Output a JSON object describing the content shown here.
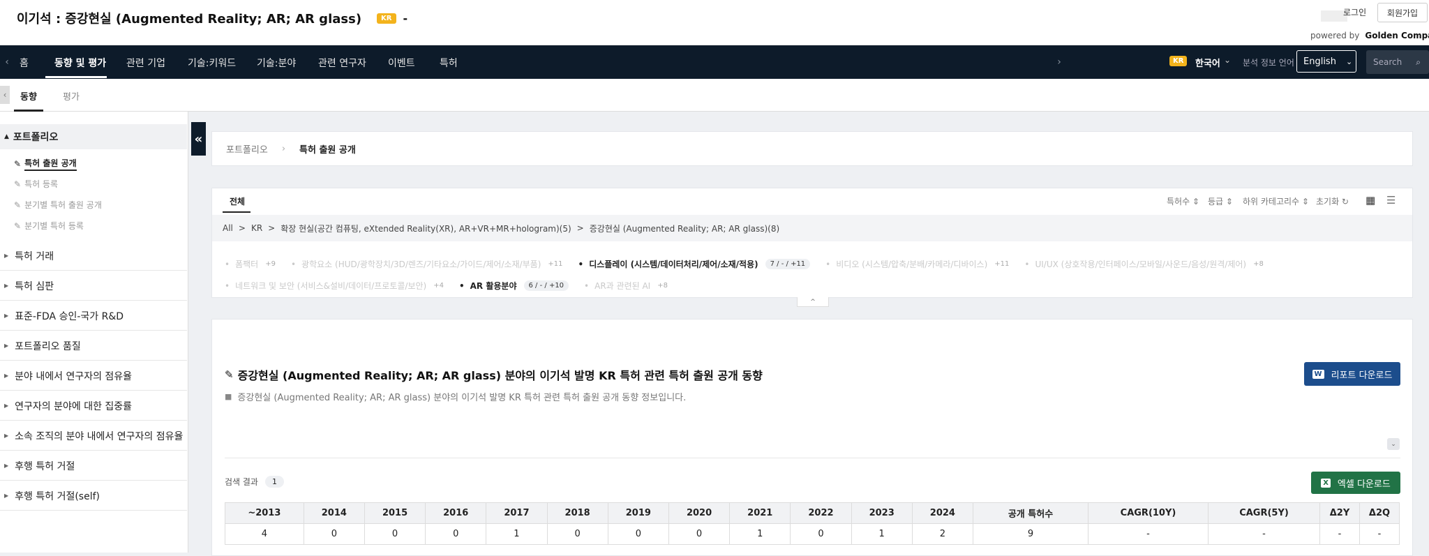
{
  "header": {
    "title": "이기석 : 증강현실 (Augmented Reality; AR; AR glass)",
    "country_badge": "KR",
    "dash": "-",
    "login": "로그인",
    "signup": "회원가입",
    "powered_by": "powered by",
    "brand": "Golden Compass"
  },
  "nav": {
    "items": [
      "홈",
      "동향 및 평가",
      "관련 기업",
      "기술:키워드",
      "기술:분야",
      "관련 연구자",
      "이벤트",
      "특허"
    ],
    "active_index": 1,
    "lang_badge": "KR",
    "lang": "한국어",
    "analysis_lang_label": "분석 정보 언어",
    "language_select": "English",
    "search_placeholder": "Search"
  },
  "subtabs": [
    "동향",
    "평가"
  ],
  "sidebar": {
    "header": "포트폴리오",
    "sub_items": [
      "특허 출원 공개",
      "특허 등록",
      "분기별 특허 출원 공개",
      "분기별 특허 등록"
    ],
    "categories": [
      "특허 거래",
      "특허 심판",
      "표준-FDA 승인-국가 R&D",
      "포트폴리오 품질",
      "분야 내에서 연구자의 점유율",
      "연구자의 분야에 대한 집중률",
      "소속 조직의 분야 내에서 연구자의 점유율",
      "후행 특허 거절",
      "후행 특허 거절(self)"
    ]
  },
  "breadcrumb": {
    "root": "포트폴리오",
    "sep": "›",
    "current": "특허 출원 공개"
  },
  "filter": {
    "tab": "전체",
    "sorts": [
      "특허수 ⇕",
      "등급 ⇕",
      "하위 카테고리수 ⇕",
      "초기화 ↻"
    ],
    "path": [
      "All",
      "KR",
      "확장 현실(공간 컴퓨팅, eXtended Reality(XR), AR+VR+MR+hologram)(5)",
      "증강현실 (Augmented Reality; AR; AR glass)(8)"
    ],
    "path_sep": ">",
    "tags_row1": [
      {
        "label": "폼팩터",
        "count": "+9",
        "strong": false
      },
      {
        "label": "광학요소 (HUD/광학장치/3D/렌즈/기타요소/가이드/제어/소재/부품)",
        "count": "+11",
        "strong": false
      },
      {
        "label": "디스플레이 (시스템/데이터처리/제어/소재/적용)",
        "count": "7 / - / +11",
        "strong": true
      },
      {
        "label": "비디오 (시스템/압축/분배/카메라/디바이스)",
        "count": "+11",
        "strong": false
      },
      {
        "label": "UI/UX (상호작용/인터페이스/모바일/사운드/음성/원격/제어)",
        "count": "+8",
        "strong": false
      }
    ],
    "tags_row2": [
      {
        "label": "네트워크 및 보안 (서비스&설비/데이터/프로토콜/보안)",
        "count": "+4",
        "strong": false
      },
      {
        "label": "AR 활용분야",
        "count": "6 / - / +10",
        "strong": true
      },
      {
        "label": "AR과 관련된 AI",
        "count": "+8",
        "strong": false
      }
    ],
    "toggle": "^"
  },
  "main": {
    "title": "증강현실 (Augmented Reality; AR; AR glass) 분야의 이기석 발명 KR 특허 관련 특허 출원 공개 동향",
    "desc": "증강현실 (Augmented Reality; AR; AR glass) 분야의 이기석 발명 KR 특허 관련 특허 출원 공개 동향 정보입니다.",
    "report_btn": "리포트 다운로드",
    "results_label": "검색 결과",
    "results_count": "1",
    "excel_btn": "엑셀 다운로드"
  },
  "table": {
    "headers": [
      "~2013",
      "2014",
      "2015",
      "2016",
      "2017",
      "2018",
      "2019",
      "2020",
      "2021",
      "2022",
      "2023",
      "2024",
      "공개 특허수",
      "CAGR(10Y)",
      "CAGR(5Y)",
      "Δ2Y",
      "Δ2Q"
    ],
    "rows": [
      [
        "4",
        "0",
        "0",
        "0",
        "1",
        "0",
        "0",
        "0",
        "1",
        "0",
        "1",
        "2",
        "9",
        "-",
        "-",
        "-",
        "-"
      ]
    ]
  },
  "colors": {
    "nav_bg": "#0d1b2a",
    "badge": "#f3b31c",
    "report_btn": "#1c4d8c",
    "excel_btn": "#217346"
  }
}
